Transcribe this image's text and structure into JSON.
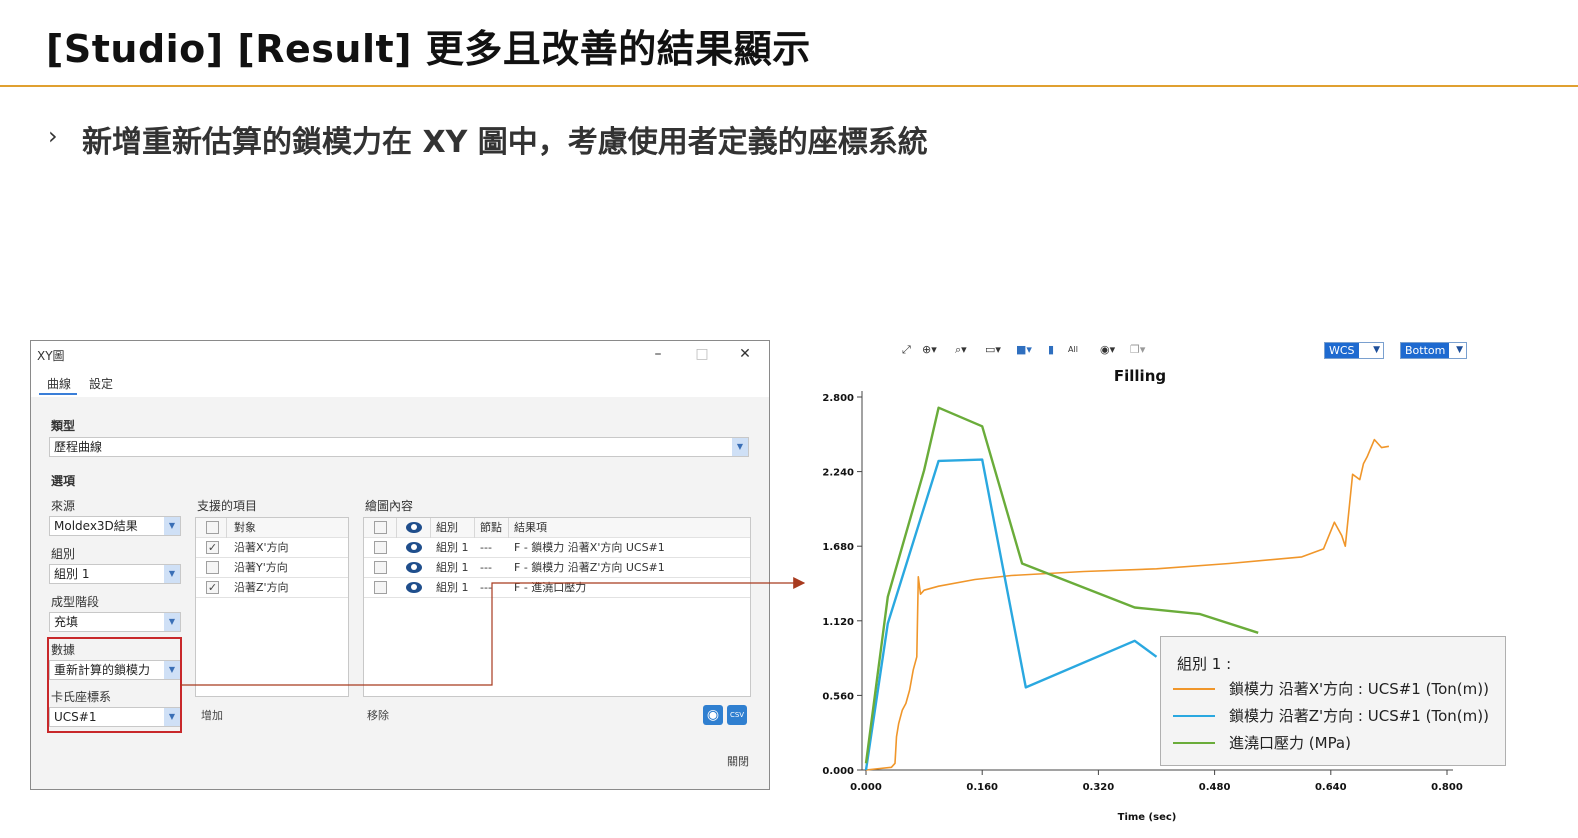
{
  "slide": {
    "title": "[Studio] [Result] 更多且改善的結果顯示",
    "bullet_mark": "›",
    "bullet": "新增重新估算的鎖模力在 XY 圖中，考慮使用者定義的座標系統"
  },
  "dialog": {
    "title": "XY圖",
    "minimize": "–",
    "maximize": "□",
    "close": "✕",
    "tabs": [
      "曲線",
      "設定"
    ],
    "type_label": "類型",
    "type_value": "歷程曲線",
    "options_label": "選項",
    "source_label": "來源",
    "source_value": "Moldex3D結果",
    "group_label": "組別",
    "group_value": "組別 1",
    "stage_label": "成型階段",
    "stage_value": "充填",
    "data_label": "數據",
    "data_value": "重新計算的鎖模力",
    "cs_label": "卡氏座標系",
    "cs_value": "UCS#1",
    "supported_label": "支援的項目",
    "supported_header": "對象",
    "supported_items": [
      {
        "checked": true,
        "label": "沿著X'方向"
      },
      {
        "checked": false,
        "label": "沿著Y'方向"
      },
      {
        "checked": true,
        "label": "沿著Z'方向"
      }
    ],
    "plot_label": "繪圖內容",
    "plot_headers": {
      "group": "組別",
      "node": "節點",
      "result": "結果項"
    },
    "plot_rows": [
      {
        "group": "組別 1",
        "node": "---",
        "result": "F - 鎖模力 沿著X'方向 UCS#1"
      },
      {
        "group": "組別 1",
        "node": "---",
        "result": "F - 鎖模力 沿著Z'方向 UCS#1"
      },
      {
        "group": "組別 1",
        "node": "---",
        "result": "F - 進澆口壓力"
      }
    ],
    "add_button": "增加",
    "remove_button": "移除",
    "csv_label": "CSV",
    "close_button": "關閉"
  },
  "viewer": {
    "all_label": "All",
    "wcs_value": "WCS",
    "view_value": "Bottom"
  },
  "chart_data": {
    "type": "line",
    "title": "Filling",
    "xlabel": "Time (sec)",
    "ylabel": "",
    "xlim": [
      0,
      0.8
    ],
    "ylim": [
      0,
      2.8
    ],
    "xticks": [
      "0.000",
      "0.160",
      "0.320",
      "0.480",
      "0.640",
      "0.800"
    ],
    "yticks": [
      "0.000",
      "0.560",
      "1.120",
      "1.680",
      "2.240",
      "2.800"
    ],
    "legend_title": "組別 1 :",
    "series": [
      {
        "name": "鎖模力 沿著X'方向 : UCS#1 (Ton(m))",
        "color": "#f0962a",
        "x": [
          0.0,
          0.035,
          0.04,
          0.042,
          0.045,
          0.05,
          0.055,
          0.06,
          0.065,
          0.07,
          0.072,
          0.075,
          0.08,
          0.1,
          0.15,
          0.2,
          0.3,
          0.4,
          0.5,
          0.6,
          0.63,
          0.645,
          0.655,
          0.66,
          0.67,
          0.68,
          0.685,
          0.69,
          0.7,
          0.71,
          0.72
        ],
        "y": [
          0.0,
          0.02,
          0.05,
          0.25,
          0.35,
          0.45,
          0.5,
          0.6,
          0.75,
          0.85,
          1.45,
          1.32,
          1.35,
          1.38,
          1.43,
          1.46,
          1.49,
          1.51,
          1.55,
          1.6,
          1.66,
          1.86,
          1.76,
          1.68,
          2.22,
          2.18,
          2.3,
          2.35,
          2.48,
          2.42,
          2.43
        ]
      },
      {
        "name": "鎖模力 沿著Z'方向 : UCS#1 (Ton(m))",
        "color": "#2aa8e0",
        "x": [
          0.0,
          0.03,
          0.1,
          0.16,
          0.22,
          0.37,
          0.4
        ],
        "y": [
          0.0,
          1.1,
          2.32,
          2.33,
          0.62,
          0.97,
          0.85
        ]
      },
      {
        "name": "進澆口壓力 (MPa)",
        "color": "#6aac3a",
        "x": [
          0.0,
          0.03,
          0.08,
          0.1,
          0.16,
          0.215,
          0.37,
          0.46,
          0.54
        ],
        "y": [
          0.05,
          1.3,
          2.25,
          2.72,
          2.58,
          1.55,
          1.22,
          1.17,
          1.03
        ]
      }
    ]
  }
}
